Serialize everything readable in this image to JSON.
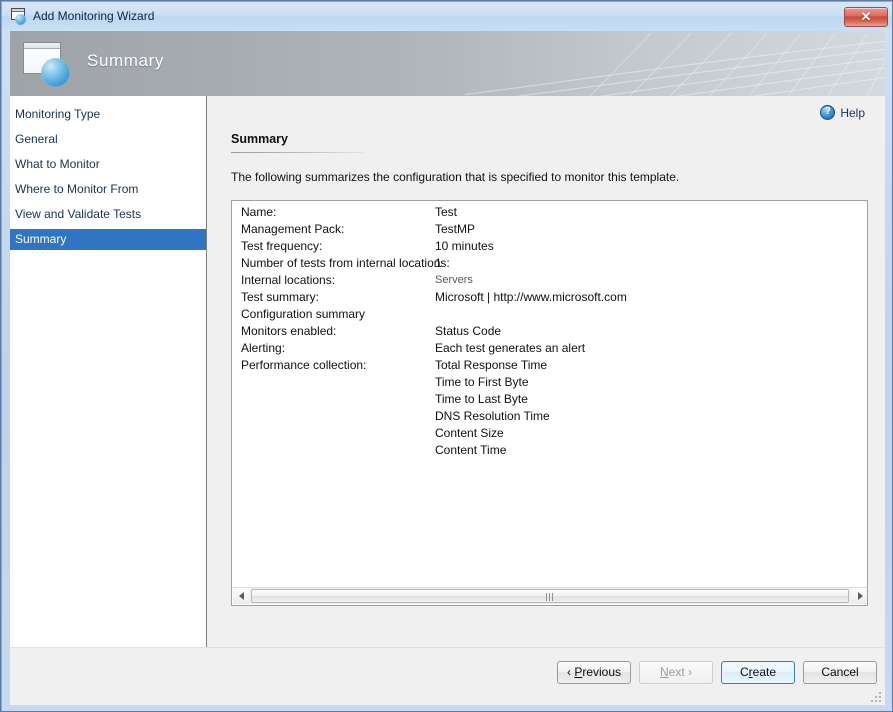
{
  "window": {
    "title": "Add Monitoring Wizard",
    "icon": "wizard-window-globe-icon",
    "close_label": "✕"
  },
  "banner": {
    "title": "Summary",
    "icon": "window-globe-icon"
  },
  "sidebar": {
    "items": [
      {
        "label": "Monitoring Type",
        "selected": false
      },
      {
        "label": "General",
        "selected": false
      },
      {
        "label": "What to Monitor",
        "selected": false
      },
      {
        "label": "Where to Monitor From",
        "selected": false
      },
      {
        "label": "View and Validate Tests",
        "selected": false
      },
      {
        "label": "Summary",
        "selected": true
      }
    ],
    "selected_color": "#2f75c4"
  },
  "content": {
    "help_label": "Help",
    "help_icon": "help-question-icon",
    "heading": "Summary",
    "intro": "The following summarizes the configuration that is specified to monitor this template.",
    "summary_rows": [
      {
        "label": "Name:",
        "value": "Test",
        "muted": false
      },
      {
        "label": "Management Pack:",
        "value": "TestMP",
        "muted": false
      },
      {
        "label": "Test frequency:",
        "value": "10 minutes",
        "muted": false
      },
      {
        "label": "Number of tests from internal locations:",
        "value": "1",
        "muted": false
      },
      {
        "label": "Internal locations:",
        "value": "Servers",
        "muted": true
      },
      {
        "label": "Test summary:",
        "value": "Microsoft | http://www.microsoft.com",
        "muted": false
      },
      {
        "label": "Configuration summary",
        "value": "",
        "muted": false
      },
      {
        "label": "Monitors enabled:",
        "value": "Status Code",
        "muted": false
      },
      {
        "label": "Alerting:",
        "value": "Each test generates an alert",
        "muted": false
      },
      {
        "label": "Performance collection:",
        "value": "Total Response Time",
        "muted": false
      },
      {
        "label": "",
        "value": "Time to First Byte",
        "muted": false
      },
      {
        "label": "",
        "value": "Time to Last Byte",
        "muted": false
      },
      {
        "label": "",
        "value": "DNS Resolution Time",
        "muted": false
      },
      {
        "label": "",
        "value": "Content Size",
        "muted": false
      },
      {
        "label": "",
        "value": "Content Time",
        "muted": false
      }
    ],
    "scrollbar": {
      "left_arrow_icon": "scroll-left-arrow-icon",
      "right_arrow_icon": "scroll-right-arrow-icon",
      "grip_icon": "scroll-thumb-grip-icon"
    }
  },
  "footer": {
    "buttons": [
      {
        "id": "previous",
        "prefix": "‹ ",
        "accel": "P",
        "rest": "revious",
        "suffix": "",
        "state": "enabled"
      },
      {
        "id": "next",
        "prefix": "",
        "accel": "N",
        "rest": "ext",
        "suffix": " ›",
        "state": "disabled"
      },
      {
        "id": "create",
        "prefix": "C",
        "accel": "r",
        "rest": "eate",
        "suffix": "",
        "state": "default"
      },
      {
        "id": "cancel",
        "prefix": "Cancel",
        "accel": "",
        "rest": "",
        "suffix": "",
        "state": "enabled"
      }
    ]
  }
}
